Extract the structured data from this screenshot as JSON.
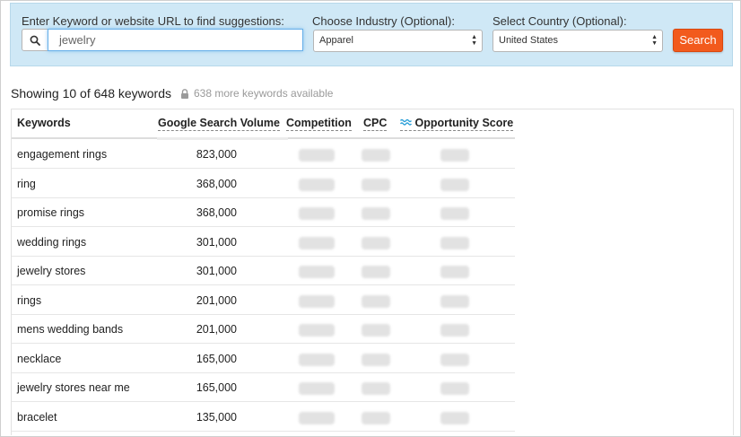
{
  "search": {
    "keyword_label": "Enter Keyword or website URL to find suggestions:",
    "keyword_value": "jewelry",
    "industry_label": "Choose Industry (Optional):",
    "industry_value": "Apparel",
    "country_label": "Select Country (Optional):",
    "country_value": "United States",
    "search_button": "Search",
    "search_icon": "search-icon"
  },
  "summary": {
    "showing_text": "Showing 10 of 648 keywords",
    "more_text": "638 more keywords available",
    "lock_icon": "lock-icon"
  },
  "table": {
    "columns": [
      "Keywords",
      "Google Search Volume",
      "Competition",
      "CPC",
      "Opportunity Score"
    ],
    "opportunity_icon": "wave-icon",
    "rows": [
      {
        "keyword": "engagement rings",
        "volume": "823,000"
      },
      {
        "keyword": "ring",
        "volume": "368,000"
      },
      {
        "keyword": "promise rings",
        "volume": "368,000"
      },
      {
        "keyword": "wedding rings",
        "volume": "301,000"
      },
      {
        "keyword": "jewelry stores",
        "volume": "301,000"
      },
      {
        "keyword": "rings",
        "volume": "201,000"
      },
      {
        "keyword": "mens wedding bands",
        "volume": "201,000"
      },
      {
        "keyword": "necklace",
        "volume": "165,000"
      },
      {
        "keyword": "jewelry stores near me",
        "volume": "165,000"
      },
      {
        "keyword": "bracelet",
        "volume": "135,000"
      }
    ]
  },
  "colors": {
    "panel_bg": "#cfe8f6",
    "search_button": "#f25a1d",
    "accent_blue": "#2a9fd8"
  }
}
